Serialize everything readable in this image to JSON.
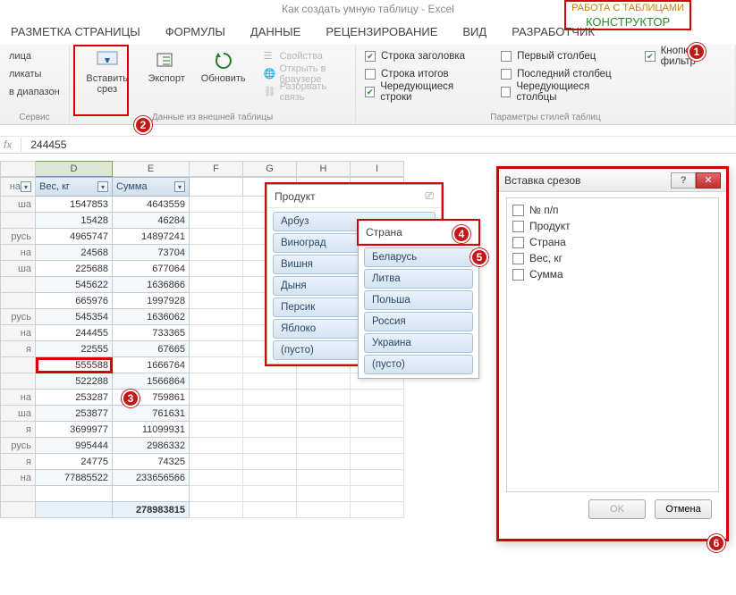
{
  "title": "Как создать умную таблицу - Excel",
  "tabletools": {
    "context": "РАБОТА С ТАБЛИЦАМИ",
    "tab": "КОНСТРУКТОР"
  },
  "tabs": [
    "РАЗМЕТКА СТРАНИЦЫ",
    "ФОРМУЛЫ",
    "ДАННЫЕ",
    "РЕЦЕНЗИРОВАНИЕ",
    "ВИД",
    "РАЗРАБОТЧИК"
  ],
  "ribbon": {
    "group1": {
      "items": [
        "лица",
        "ликаты",
        "в диапазон"
      ],
      "label": "Сервис"
    },
    "group2": {
      "insert_slicer": "Вставить\nсрез",
      "export": "Экспорт",
      "refresh": "Обновить",
      "props": "Свойства",
      "open_browser": "Открыть в браузере",
      "unlink": "Разорвать связь",
      "label": "Данные из внешней таблицы"
    },
    "group3": {
      "header_row": "Строка заголовка",
      "total_row": "Строка итогов",
      "banded_rows": "Чередующиеся строки",
      "first_col": "Первый столбец",
      "last_col": "Последний столбец",
      "banded_cols": "Чередующиеся столбцы",
      "filter_btn": "Кнопка фильтр",
      "label": "Параметры стилей таблиц"
    },
    "checked": {
      "header_row": true,
      "banded_rows": true,
      "filter_btn": true
    }
  },
  "formula_bar": {
    "value": "244455"
  },
  "columns": [
    "D",
    "E",
    "F",
    "G",
    "H",
    "I"
  ],
  "table_headers": {
    "country": "на",
    "weight": "Вес, кг",
    "sum": "Сумма"
  },
  "rows": [
    {
      "c": "ша",
      "w": "1547853",
      "s": "4643559"
    },
    {
      "c": "",
      "w": "15428",
      "s": "46284"
    },
    {
      "c": "русь",
      "w": "4965747",
      "s": "14897241"
    },
    {
      "c": "на",
      "w": "24568",
      "s": "73704"
    },
    {
      "c": "ша",
      "w": "225688",
      "s": "677064"
    },
    {
      "c": "",
      "w": "545622",
      "s": "1636866"
    },
    {
      "c": "",
      "w": "665976",
      "s": "1997928"
    },
    {
      "c": "русь",
      "w": "545354",
      "s": "1636062"
    },
    {
      "c": "на",
      "w": "244455",
      "s": "733365"
    },
    {
      "c": "я",
      "w": "22555",
      "s": "67665"
    },
    {
      "c": "",
      "w": "555588",
      "s": "1666764"
    },
    {
      "c": "",
      "w": "522288",
      "s": "1566864"
    },
    {
      "c": "на",
      "w": "253287",
      "s": "759861"
    },
    {
      "c": "ша",
      "w": "253877",
      "s": "761631"
    },
    {
      "c": "я",
      "w": "3699977",
      "s": "11099931"
    },
    {
      "c": "русь",
      "w": "995444",
      "s": "2986332"
    },
    {
      "c": "я",
      "w": "24775",
      "s": "74325"
    },
    {
      "c": "на",
      "w": "77885522",
      "s": "233656566"
    }
  ],
  "grand_total": "278983815",
  "slicer_product": {
    "title": "Продукт",
    "items": [
      "Арбуз",
      "Виноград",
      "Вишня",
      "Дыня",
      "Персик",
      "Яблоко",
      "(пусто)"
    ]
  },
  "slicer_country": {
    "title": "Страна",
    "items": [
      "Беларусь",
      "Литва",
      "Польша",
      "Россия",
      "Украина",
      "(пусто)"
    ]
  },
  "dialog": {
    "title": "Вставка срезов",
    "fields": [
      "№ п/п",
      "Продукт",
      "Страна",
      "Вес, кг",
      "Сумма"
    ],
    "ok": "OK",
    "cancel": "Отмена"
  },
  "markers": [
    "1",
    "2",
    "3",
    "4",
    "5",
    "6"
  ]
}
